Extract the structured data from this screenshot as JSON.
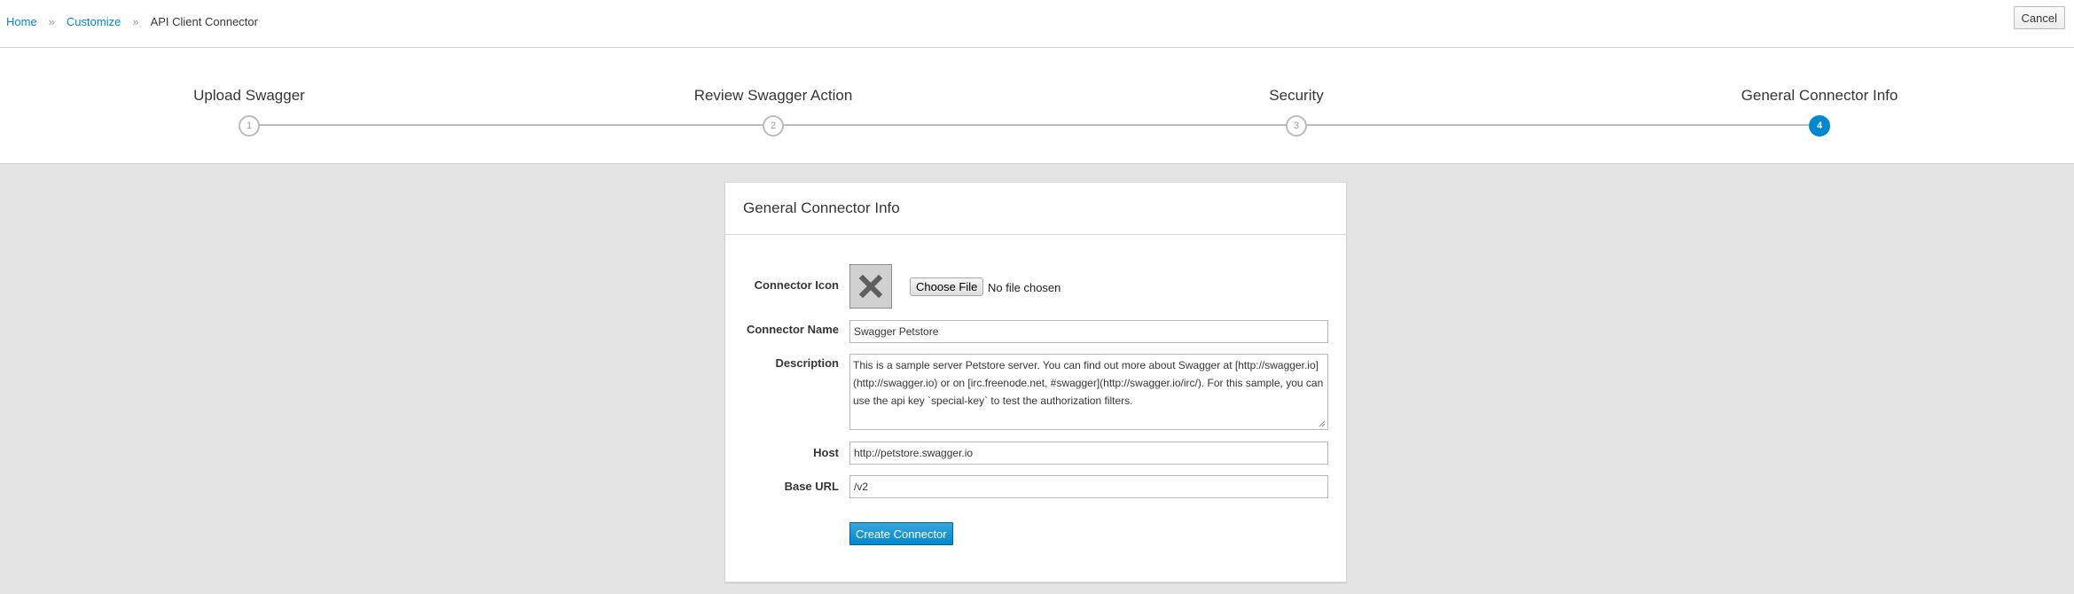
{
  "breadcrumb": {
    "home": "Home",
    "customize": "Customize",
    "current": "API Client Connector",
    "separator": "»"
  },
  "header": {
    "cancel_label": "Cancel"
  },
  "wizard": {
    "steps": [
      {
        "number": "1",
        "label": "Upload Swagger",
        "state": "pending"
      },
      {
        "number": "2",
        "label": "Review Swagger Action",
        "state": "pending"
      },
      {
        "number": "3",
        "label": "Security",
        "state": "pending"
      },
      {
        "number": "4",
        "label": "General Connector Info",
        "state": "active"
      }
    ],
    "accent_color": "#0088ce"
  },
  "form": {
    "title": "General Connector Info",
    "icon_label": "Connector Icon",
    "icon_placeholder": "close-icon",
    "choose_file_label": "Choose File",
    "no_file_text": "No file chosen",
    "name_label": "Connector Name",
    "name_value": "Swagger Petstore",
    "description_label": "Description",
    "description_value": "This is a sample server Petstore server.  You can find out more about Swagger at [http://swagger.io](http://swagger.io) or on [irc.freenode.net, #swagger](http://swagger.io/irc/).  For this sample, you can use the api key `special-key` to test the authorization filters.",
    "host_label": "Host",
    "host_value": "http://petstore.swagger.io",
    "base_url_label": "Base URL",
    "base_url_value": "/v2",
    "submit_label": "Create Connector"
  }
}
